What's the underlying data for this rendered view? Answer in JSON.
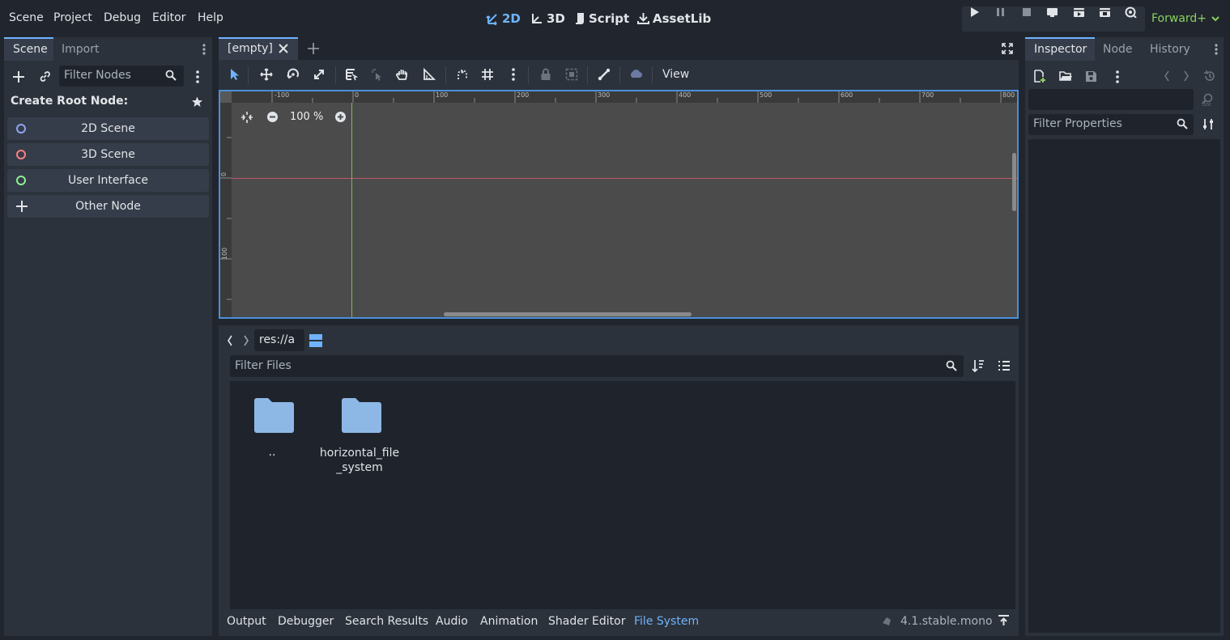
{
  "menu": [
    "Scene",
    "Project",
    "Debug",
    "Editor",
    "Help"
  ],
  "workspaces": [
    {
      "label": "2D",
      "active": true
    },
    {
      "label": "3D",
      "active": false
    },
    {
      "label": "Script",
      "active": false
    },
    {
      "label": "AssetLib",
      "active": false
    }
  ],
  "renderer": "Forward+",
  "scene_dock": {
    "tabs": [
      "Scene",
      "Import"
    ],
    "filter_placeholder": "Filter Nodes",
    "create_root_label": "Create Root Node:",
    "root_options": [
      {
        "label": "2D Scene",
        "color": "#8da5f3"
      },
      {
        "label": "3D Scene",
        "color": "#fc7f7f"
      },
      {
        "label": "User Interface",
        "color": "#8eef97"
      },
      {
        "label": "Other Node",
        "color": "#dfe3e8"
      }
    ]
  },
  "editor": {
    "scene_tab": "[empty]",
    "view_menu": "View",
    "zoom": "100 %",
    "ruler_top": [
      "-100",
      "0",
      "100",
      "200",
      "300",
      "400",
      "500",
      "600",
      "700",
      "800"
    ],
    "ruler_left": [
      "0",
      "100"
    ]
  },
  "filesystem": {
    "path": "res://a",
    "filter_placeholder": "Filter Files",
    "items": [
      {
        "label": ".."
      },
      {
        "label": "horizontal_file\n_system"
      }
    ]
  },
  "bottom_panel": {
    "tabs": [
      "Output",
      "Debugger",
      "Search Results",
      "Audio",
      "Animation",
      "Shader Editor",
      "File System"
    ],
    "active_tab": "File System",
    "version": "4.1.stable.mono"
  },
  "inspector": {
    "tabs": [
      "Inspector",
      "Node",
      "History"
    ],
    "filter_placeholder": "Filter Properties"
  }
}
